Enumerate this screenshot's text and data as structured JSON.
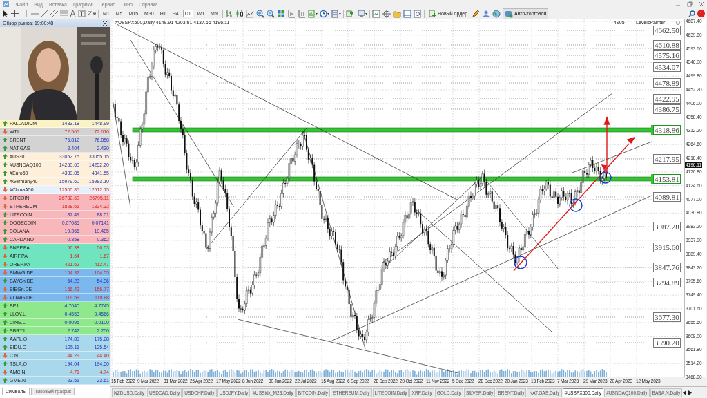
{
  "menu": [
    "Файл",
    "Вид",
    "Вставка",
    "Графики",
    "Сервис",
    "Окно",
    "Справка"
  ],
  "toolbar": {
    "timeframes": [
      {
        "label": "M1",
        "selected": false
      },
      {
        "label": "M5",
        "selected": false
      },
      {
        "label": "M15",
        "selected": false
      },
      {
        "label": "M30",
        "selected": false
      },
      {
        "label": "H1",
        "selected": false
      },
      {
        "label": "H4",
        "selected": false
      },
      {
        "label": "D1",
        "selected": true
      },
      {
        "label": "W1",
        "selected": false
      },
      {
        "label": "MN",
        "selected": false
      }
    ],
    "buttons": [
      {
        "label": "Новый ордер"
      },
      {
        "label": "Авто-торговля"
      }
    ]
  },
  "notifications": {
    "count": "1"
  },
  "market_watch": {
    "title": "Обзор рынка: 19:00:48",
    "rows": [
      {
        "symbol": "PALLADIUM",
        "bid": "1433.18",
        "ask": "1448.99",
        "rising": true,
        "color": "#fbf3c4"
      },
      {
        "symbol": "WTI",
        "bid": "72.565",
        "ask": "72.610",
        "rising": false,
        "color": "#d3d3d3"
      },
      {
        "symbol": "BRENT",
        "bid": "76.812",
        "ask": "76.858",
        "rising": true,
        "color": "#d3d3d3"
      },
      {
        "symbol": "NAT.GAS",
        "bid": "2.404",
        "ask": "2.430",
        "rising": true,
        "color": "#d3d3d3"
      },
      {
        "symbol": "#US30",
        "bid": "33052.75",
        "ask": "33055.15",
        "rising": true,
        "color": "#fdefd9"
      },
      {
        "symbol": "#USNDAQ100",
        "bid": "14250.60",
        "ask": "14252.20",
        "rising": true,
        "color": "#fdefd9"
      },
      {
        "symbol": "#Euro50",
        "bid": "4339.85",
        "ask": "4341.55",
        "rising": true,
        "color": "#fdefd9"
      },
      {
        "symbol": "#Germany40",
        "bid": "15979.60",
        "ask": "15983.10",
        "rising": true,
        "color": "#fdefd9"
      },
      {
        "symbol": "#ChinaA50",
        "bid": "12560.85",
        "ask": "12612.15",
        "rising": false,
        "color": "#e6f1fc"
      },
      {
        "symbol": "BITCOIN",
        "bid": "26732.60",
        "ask": "26795.11",
        "rising": false,
        "color": "#f8b7bb"
      },
      {
        "symbol": "ETHEREUM",
        "bid": "1828.61",
        "ask": "1834.32",
        "rising": false,
        "color": "#f8b7bb"
      },
      {
        "symbol": "LITECOIN",
        "bid": "87.49",
        "ask": "88.01",
        "rising": true,
        "color": "#f8b7bb"
      },
      {
        "symbol": "DOGECOIN",
        "bid": "0.07085",
        "ask": "0.07141",
        "rising": true,
        "color": "#f8b7bb"
      },
      {
        "symbol": "SOLANA",
        "bid": "19.366",
        "ask": "19.485",
        "rising": true,
        "color": "#f8b7bb"
      },
      {
        "symbol": "CARDANO",
        "bid": "0.358",
        "ask": "0.362",
        "rising": true,
        "color": "#f8b7bb"
      },
      {
        "symbol": "BNPP.PA",
        "bid": "56.38",
        "ask": "56.53",
        "rising": false,
        "color": "#6fe4bf"
      },
      {
        "symbol": "AIRF.PA",
        "bid": "1.64",
        "ask": "1.67",
        "rising": false,
        "color": "#6fe4bf"
      },
      {
        "symbol": "OREP.PA",
        "bid": "411.62",
        "ask": "412.47",
        "rising": false,
        "color": "#6fe4bf"
      },
      {
        "symbol": "BMWG.DE",
        "bid": "104.32",
        "ask": "104.55",
        "rising": false,
        "color": "#7ab8ee"
      },
      {
        "symbol": "BAYGn.DE",
        "bid": "54.23",
        "ask": "54.36",
        "rising": true,
        "color": "#7ab8ee"
      },
      {
        "symbol": "SIEGn.DE",
        "bid": "156.42",
        "ask": "156.77",
        "rising": false,
        "color": "#7ab8ee"
      },
      {
        "symbol": "VOWG.DE",
        "bid": "119.58",
        "ask": "119.88",
        "rising": false,
        "color": "#7ab8ee"
      },
      {
        "symbol": "BP.L",
        "bid": "4.7640",
        "ask": "4.7745",
        "rising": true,
        "color": "#8fe88b"
      },
      {
        "symbol": "LLOY.L",
        "bid": "0.4553",
        "ask": "0.4566",
        "rising": true,
        "color": "#8fe88b"
      },
      {
        "symbol": "CINE.L",
        "bid": "0.0095",
        "ask": "0.0100",
        "rising": true,
        "color": "#8fe88b"
      },
      {
        "symbol": "SBRY.L",
        "bid": "2.742",
        "ask": "2.750",
        "rising": true,
        "color": "#8fe88b"
      },
      {
        "symbol": "AAPL.O",
        "bid": "174.89",
        "ask": "175.28",
        "rising": true,
        "color": "#a9d7eb"
      },
      {
        "symbol": "BIDU.O",
        "bid": "125.11",
        "ask": "125.54",
        "rising": true,
        "color": "#a9d7eb"
      },
      {
        "symbol": "C.N",
        "bid": "44.29",
        "ask": "44.40",
        "rising": false,
        "color": "#a9d7eb"
      },
      {
        "symbol": "TSLA.O",
        "bid": "194.04",
        "ask": "194.50",
        "rising": true,
        "color": "#a9d7eb"
      },
      {
        "symbol": "AMC.N",
        "bid": "4.71",
        "ask": "4.74",
        "rising": false,
        "color": "#a9d7eb"
      },
      {
        "symbol": "GME.N",
        "bid": "23.51",
        "ask": "23.61",
        "rising": true,
        "color": "#a9d7eb"
      }
    ],
    "tabs": [
      {
        "label": "Символы",
        "selected": true
      },
      {
        "label": "Тиковый график",
        "selected": false
      }
    ]
  },
  "chart": {
    "header": "#USSPX500,Daily 4149.91 4203.61 4137.66 4196.11",
    "counter": "4905",
    "indicator": "LevelsPainter",
    "levels": [
      {
        "label": "4662.50",
        "zone": false
      },
      {
        "label": "4610.88",
        "zone": false
      },
      {
        "label": "4575.16",
        "zone": false
      },
      {
        "label": "4534.07",
        "zone": false
      },
      {
        "label": "4478.89",
        "zone": false
      },
      {
        "label": "4422.95",
        "zone": false
      },
      {
        "label": "4386.75",
        "zone": false
      },
      {
        "label": "4318.86",
        "zone": true
      },
      {
        "label": "4217.95",
        "zone": false
      },
      {
        "label": "4153.81",
        "zone": true
      },
      {
        "label": "4089.81",
        "zone": false
      },
      {
        "label": "3987.28",
        "zone": false
      },
      {
        "label": "3915.60",
        "zone": false
      },
      {
        "label": "3847.76",
        "zone": false
      },
      {
        "label": "3794.89",
        "zone": false
      },
      {
        "label": "3677.30",
        "zone": false
      },
      {
        "label": "3590.20",
        "zone": false
      }
    ],
    "price_ticks": [
      "4687.40",
      "4639.80",
      "4593.60",
      "4546.00",
      "4499.80",
      "4452.20",
      "4406.00",
      "4358.40",
      "4312.20",
      "4264.60",
      "4218.40",
      "4170.80",
      "4124.60",
      "4077.00",
      "4030.80",
      "3983.20",
      "3937.00",
      "3889.40",
      "3843.20",
      "3795.60",
      "3749.40",
      "3701.60",
      "3655.60",
      "3608.00",
      "3561.80",
      "3514.20",
      "3468.00"
    ],
    "current_price": "4196.11",
    "dates": [
      "15 Feb 2022",
      "9 Mar 2022",
      "31 Mar 2022",
      "25 Apr 2022",
      "17 May 2022",
      "8 Jun 2022",
      "30 Jun 2022",
      "22 Jul 2022",
      "15 Aug 2022",
      "6 Sep 2022",
      "28 Sep 2022",
      "20 Oct 2022",
      "11 Nov 2022",
      "5 Dec 2022",
      "28 Dec 2022",
      "20 Jan 2023",
      "13 Feb 2023",
      "7 Mar 2023",
      "29 Mar 2023",
      "20 Apr 2023",
      "12 May 2023"
    ]
  },
  "chart_tabs": [
    {
      "label": "NZDUSD,Daily",
      "selected": false
    },
    {
      "label": "USDCAD,Daily",
      "selected": false
    },
    {
      "label": "USDCHF,Daily",
      "selected": false
    },
    {
      "label": "USDJPY,Daily",
      "selected": false
    },
    {
      "label": "#USSidx_M23,Daily",
      "selected": false
    },
    {
      "label": "BITCOIN,Daily",
      "selected": false
    },
    {
      "label": "ETHEREUM,Daily",
      "selected": false
    },
    {
      "label": "LITECOIN,Daily",
      "selected": false
    },
    {
      "label": "XRP,Daily",
      "selected": false
    },
    {
      "label": "GOLD,Daily",
      "selected": false
    },
    {
      "label": "SILVER,Daily",
      "selected": false
    },
    {
      "label": "BRENT,Daily",
      "selected": false
    },
    {
      "label": "NAT.GAS,Daily",
      "selected": false
    },
    {
      "label": "#USSPX500,Daily",
      "selected": true
    },
    {
      "label": "#USNDAQ100,Daily",
      "selected": false
    },
    {
      "label": "BABA.N,Daily",
      "selected": false
    }
  ]
}
